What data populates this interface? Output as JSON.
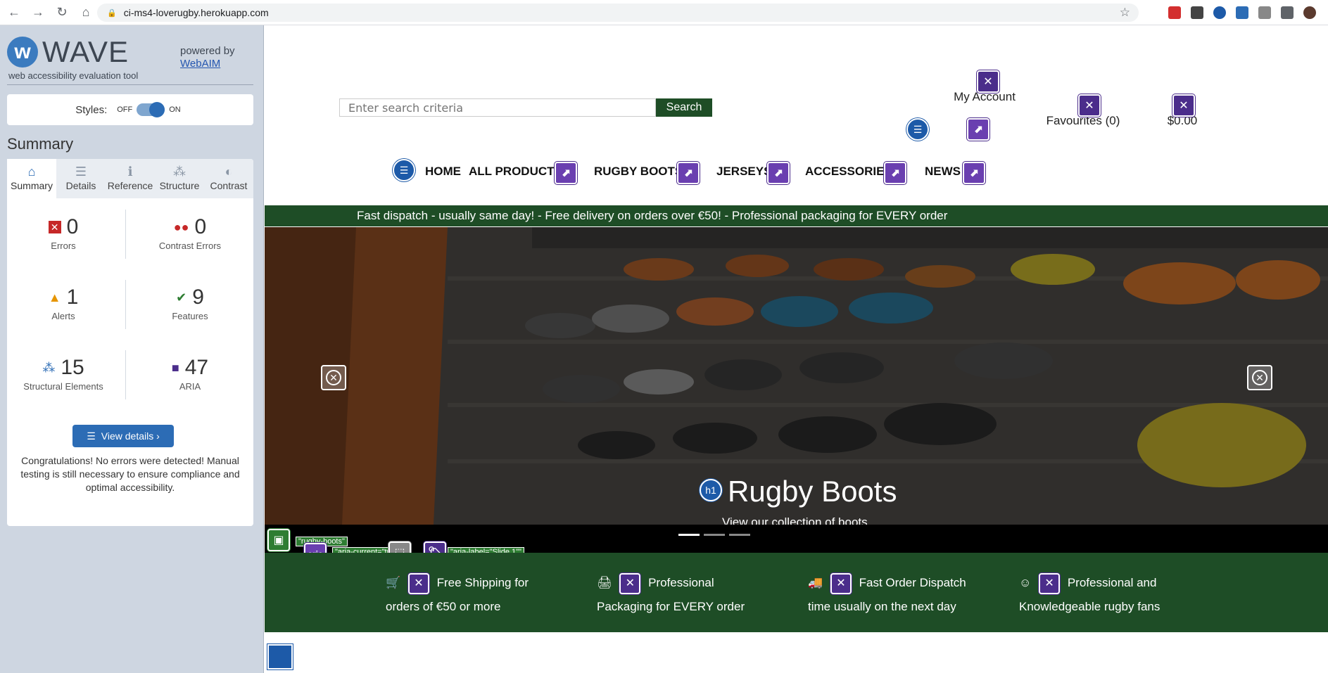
{
  "browser": {
    "url": "ci-ms4-loverugby.herokuapp.com",
    "back_icon": "←",
    "forward_icon": "→",
    "reload_icon": "↻",
    "home_icon": "⌂",
    "lock_icon": "🔒",
    "star_icon": "☆"
  },
  "wave": {
    "logo_letter": "w",
    "title": "WAVE",
    "subtitle": "web accessibility evaluation tool",
    "powered_by": "powered by",
    "webaim_link": "WebAIM",
    "styles_label": "Styles:",
    "off": "OFF",
    "on": "ON",
    "summary_heading": "Summary",
    "tabs": [
      {
        "label": "Summary",
        "icon": "⌂"
      },
      {
        "label": "Details",
        "icon": "☰"
      },
      {
        "label": "Reference",
        "icon": "ℹ"
      },
      {
        "label": "Structure",
        "icon": "⁂"
      },
      {
        "label": "Contrast",
        "icon": "◐"
      }
    ],
    "stats": {
      "errors": {
        "value": "0",
        "label": "Errors"
      },
      "contrast": {
        "value": "0",
        "label": "Contrast Errors"
      },
      "alerts": {
        "value": "1",
        "label": "Alerts"
      },
      "features": {
        "value": "9",
        "label": "Features"
      },
      "structural": {
        "value": "15",
        "label": "Structural Elements"
      },
      "aria": {
        "value": "47",
        "label": "ARIA"
      }
    },
    "view_details": "View details ›",
    "congrats": "Congratulations! No errors were detected! Manual testing is still necessary to ensure compliance and optimal accessibility."
  },
  "site": {
    "search_placeholder": "Enter search criteria",
    "search_button": "Search",
    "my_account": "My Account",
    "favourites": "Favourites (0)",
    "cart_total": "$0.00",
    "nav": [
      "HOME",
      "ALL PRODUCTS",
      "RUGBY BOOTS",
      "JERSEYS",
      "ACCESSORIES",
      "NEWS"
    ],
    "banner": "Fast dispatch - usually same day! - Free delivery on orders over €50! - Professional packaging for EVERY order",
    "hero_title": "Rugby Boots",
    "hero_subtitle": "View our collection of boots",
    "h1_badge": "h1",
    "tags": {
      "alt": "\"rugby-boots\"",
      "aria_current": "\"aria-current=\"true\"\"",
      "aria_label": "\"aria-label=\"Slide 1\"\""
    },
    "aria_badge": "aria",
    "features": [
      {
        "icon": "🛒",
        "text": "Free Shipping for orders of €50 or more"
      },
      {
        "icon": "🖨",
        "text": "Professional Packaging for EVERY order"
      },
      {
        "icon": "🚚",
        "text": "Fast Order Dispatch time usually on the next day"
      },
      {
        "icon": "☺",
        "text": "Professional and Knowledgeable rugby fans"
      }
    ]
  },
  "colors": {
    "brand_green": "#1e4d26",
    "wave_blue": "#2c6cb5",
    "aria_purple": "#4b2d8b"
  }
}
